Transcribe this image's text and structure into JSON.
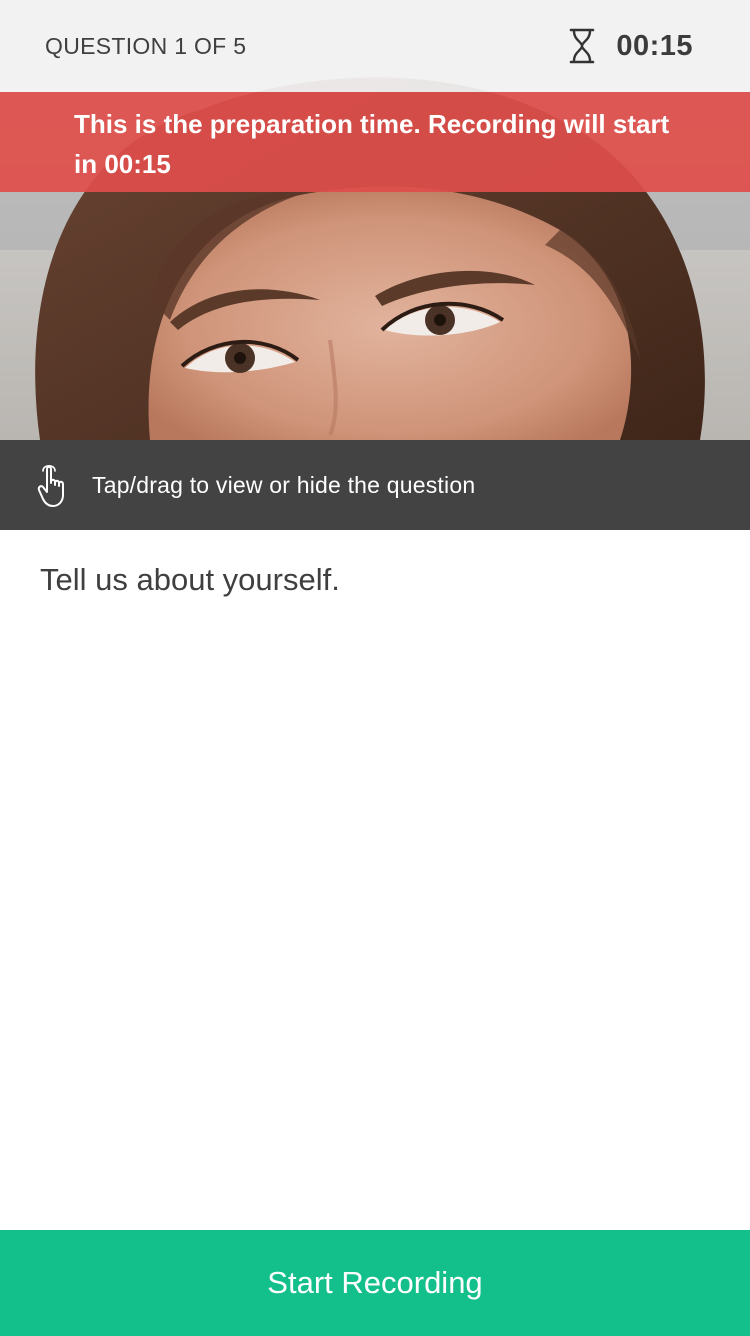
{
  "header": {
    "question_counter": "QUESTION 1 OF 5",
    "timer": "00:15",
    "timer_icon": "hourglass-icon"
  },
  "banner": {
    "text": "This is the preparation time. Recording will start in 00:15",
    "color": "#de4e4a"
  },
  "hint": {
    "icon": "hand-pointer-icon",
    "text": "Tap/drag to view or hide the question"
  },
  "question": {
    "text": "Tell us about yourself."
  },
  "actions": {
    "start_recording_label": "Start Recording",
    "color": "#13bf8a"
  }
}
